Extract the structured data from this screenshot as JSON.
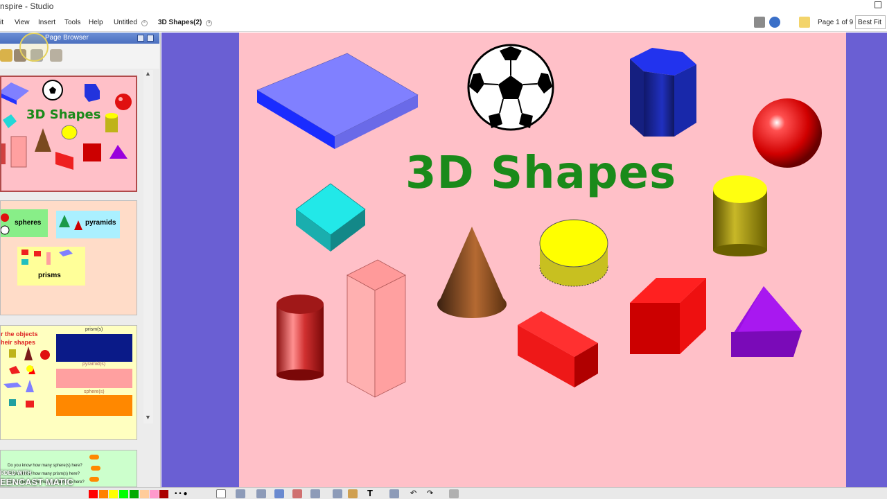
{
  "window": {
    "title": "nspire - Studio"
  },
  "menu": {
    "items": [
      "it",
      "View",
      "Insert",
      "Tools",
      "Help"
    ]
  },
  "tabs": [
    {
      "label": "Untitled",
      "close_icon": "close-icon"
    },
    {
      "label": "3D Shapes(2)",
      "close_icon": "close-icon",
      "active": true
    }
  ],
  "toolbar": {
    "page_indicator": "Page 1 of 9",
    "zoom": "Best Fit"
  },
  "page_browser": {
    "title": "Page Browser",
    "thumbnails": [
      {
        "title": "3D Shapes"
      },
      {
        "labels": [
          "spheres",
          "pyramids",
          "prisms"
        ]
      },
      {
        "heading_lines": [
          "r the objects",
          "heir shapes"
        ],
        "bins": [
          "prism(s)",
          "pyramid(s)",
          "sphere(s)"
        ]
      },
      {
        "questions": [
          "Do you know how many sphere(s) here?",
          "Do you know how many prism(s) here?",
          "Do you know how many pyramid(s) here?"
        ]
      }
    ]
  },
  "slide": {
    "title": "3D Shapes",
    "background": "#ffc0c8",
    "title_color": "#1a8a1a",
    "shapes": [
      "flat-prism",
      "soccer-ball",
      "hexagonal-prism",
      "sphere",
      "cube",
      "cone",
      "cylinder-short",
      "cylinder-yellow",
      "cylinder-red",
      "rect-prism-tall",
      "rect-prism-red",
      "cube-red",
      "triangular-prism"
    ]
  },
  "bottom_toolbar": {
    "colors": [
      "#ff0000",
      "#ff8000",
      "#ffff00",
      "#00ff00",
      "#00aa00",
      "#ffcc99",
      "#ff99cc",
      "#aa0000"
    ],
    "watermark_top": "RDED WITH",
    "watermark": "EENCAST MATIC"
  },
  "colors": {
    "canvas_bg": "#6a5fd3",
    "accent_green": "#1a8a1a"
  }
}
